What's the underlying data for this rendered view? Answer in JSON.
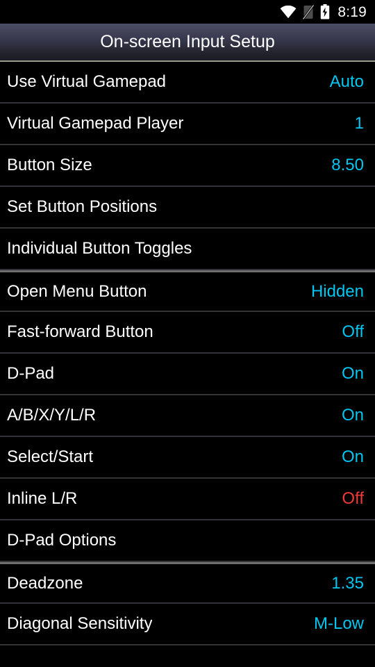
{
  "status_bar": {
    "icons": [
      {
        "name": "wifi-icon",
        "label": "wifi"
      },
      {
        "name": "signal-off-icon",
        "label": "no-cellular-signal"
      },
      {
        "name": "battery-charging-icon",
        "label": "battery-charging"
      }
    ],
    "time": "8:19"
  },
  "title_bar": {
    "title": "On-screen Input Setup"
  },
  "colors": {
    "value_accent": "#00c6f0",
    "value_warn": "#f03a3a",
    "label": "#ffffff",
    "background": "#000000",
    "divider": "#333338",
    "section_divider": "#6e6e6e",
    "title_gradient_top": "#4b4d66",
    "title_gradient_bottom": "#1a1a21",
    "title_underline": "#9c9c8e"
  },
  "settings_list": {
    "rows": [
      {
        "name": "use-virtual-gamepad",
        "label": "Use Virtual Gamepad",
        "value": "Auto",
        "value_style": "accent",
        "section_start": false
      },
      {
        "name": "virtual-gamepad-player",
        "label": "Virtual Gamepad Player",
        "value": "1",
        "value_style": "accent",
        "section_start": false
      },
      {
        "name": "button-size",
        "label": "Button Size",
        "value": "8.50",
        "value_style": "accent",
        "section_start": false
      },
      {
        "name": "set-button-positions",
        "label": "Set Button Positions",
        "value": "",
        "value_style": "accent",
        "section_start": false
      },
      {
        "name": "individual-button-toggles",
        "label": "Individual Button Toggles",
        "value": "",
        "value_style": "accent",
        "section_start": false
      },
      {
        "name": "open-menu-button",
        "label": "Open Menu Button",
        "value": "Hidden",
        "value_style": "accent",
        "section_start": true
      },
      {
        "name": "fast-forward-button",
        "label": "Fast-forward Button",
        "value": "Off",
        "value_style": "accent",
        "section_start": false
      },
      {
        "name": "d-pad",
        "label": "D-Pad",
        "value": "On",
        "value_style": "accent",
        "section_start": false
      },
      {
        "name": "face-shoulder-buttons",
        "label": "A/B/X/Y/L/R",
        "value": "On",
        "value_style": "accent",
        "section_start": false
      },
      {
        "name": "select-start",
        "label": "Select/Start",
        "value": "On",
        "value_style": "accent",
        "section_start": false
      },
      {
        "name": "inline-lr",
        "label": "Inline L/R",
        "value": "Off",
        "value_style": "warn",
        "section_start": false
      },
      {
        "name": "d-pad-options",
        "label": "D-Pad Options",
        "value": "",
        "value_style": "accent",
        "section_start": false
      },
      {
        "name": "deadzone",
        "label": "Deadzone",
        "value": "1.35",
        "value_style": "accent",
        "section_start": true
      },
      {
        "name": "diagonal-sensitivity",
        "label": "Diagonal Sensitivity",
        "value": "M-Low",
        "value_style": "accent",
        "section_start": false
      }
    ]
  }
}
